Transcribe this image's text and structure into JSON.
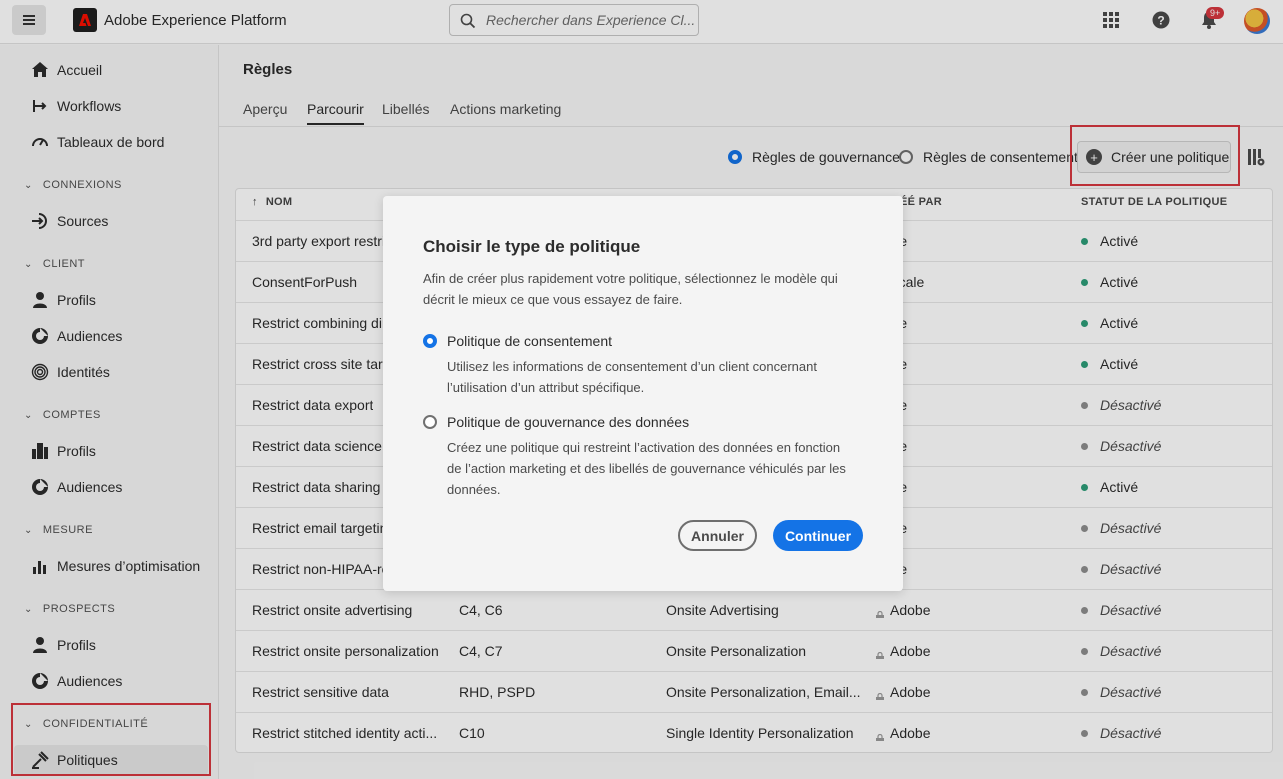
{
  "app": {
    "title": "Adobe Experience Platform"
  },
  "search": {
    "placeholder": "Rechercher dans Experience Cl..."
  },
  "topbar": {
    "notifications_badge": "9+"
  },
  "sidebar": {
    "items": [
      {
        "label": "Accueil",
        "icon": "home-icon"
      },
      {
        "label": "Workflows",
        "icon": "workflow-icon"
      },
      {
        "label": "Tableaux de bord",
        "icon": "dashboard-icon"
      }
    ],
    "sections": [
      {
        "label": "CONNEXIONS",
        "items": [
          {
            "label": "Sources",
            "icon": "sources-icon"
          }
        ]
      },
      {
        "label": "CLIENT",
        "items": [
          {
            "label": "Profils",
            "icon": "profile-icon"
          },
          {
            "label": "Audiences",
            "icon": "audience-icon"
          },
          {
            "label": "Identités",
            "icon": "fingerprint-icon"
          }
        ]
      },
      {
        "label": "COMPTES",
        "items": [
          {
            "label": "Profils",
            "icon": "building-icon"
          },
          {
            "label": "Audiences",
            "icon": "audience-icon"
          }
        ]
      },
      {
        "label": "MESURE",
        "items": [
          {
            "label": "Mesures d’optimisation",
            "icon": "metrics-icon"
          }
        ]
      },
      {
        "label": "PROSPECTS",
        "items": [
          {
            "label": "Profils",
            "icon": "profile-icon"
          },
          {
            "label": "Audiences",
            "icon": "audience-icon"
          }
        ]
      },
      {
        "label": "CONFIDENTIALITÉ",
        "items": [
          {
            "label": "Politiques",
            "icon": "policy-icon"
          }
        ]
      }
    ]
  },
  "main": {
    "title": "Règles",
    "tabs": [
      "Aperçu",
      "Parcourir",
      "Libellés",
      "Actions marketing"
    ],
    "selected_tab": "Parcourir",
    "filter": {
      "governance_label": "Règles de gouvernance",
      "consent_label": "Règles de consentement",
      "selected": "governance"
    },
    "create_button": "Créer une politique",
    "table": {
      "headers": {
        "name": "NOM",
        "created_by": "ÉÉ PAR",
        "status": "STATUT DE LA POLITIQUE"
      },
      "rows": [
        {
          "name": "3rd party export restric",
          "labels": "",
          "actions": "",
          "created_by": "dobe",
          "status": "Activé",
          "active": true
        },
        {
          "name": "ConsentForPush",
          "labels": "",
          "actions": "",
          "created_by": "o locale",
          "status": "Activé",
          "active": true
        },
        {
          "name": "Restrict combining dire",
          "labels": "",
          "actions": "",
          "created_by": "dobe",
          "status": "Activé",
          "active": true
        },
        {
          "name": "Restrict cross site target",
          "labels": "",
          "actions": "",
          "created_by": "dobe",
          "status": "Activé",
          "active": true
        },
        {
          "name": "Restrict data export",
          "labels": "",
          "actions": "",
          "created_by": "dobe",
          "status": "Désactivé",
          "active": false
        },
        {
          "name": "Restrict data science",
          "labels": "",
          "actions": "",
          "created_by": "dobe",
          "status": "Désactivé",
          "active": false
        },
        {
          "name": "Restrict data sharing",
          "labels": "",
          "actions": "",
          "created_by": "dobe",
          "status": "Activé",
          "active": true
        },
        {
          "name": "Restrict email targeting",
          "labels": "",
          "actions": "",
          "created_by": "dobe",
          "status": "Désactivé",
          "active": false
        },
        {
          "name": "Restrict non-HIPAA-rea",
          "labels": "",
          "actions": "",
          "created_by": "dobe",
          "status": "Désactivé",
          "active": false
        },
        {
          "name": "Restrict onsite advertising",
          "labels": "C4, C6",
          "actions": "Onsite Advertising",
          "created_by": "Adobe",
          "status": "Désactivé",
          "active": false
        },
        {
          "name": "Restrict onsite personalization",
          "labels": "C4, C7",
          "actions": "Onsite Personalization",
          "created_by": "Adobe",
          "status": "Désactivé",
          "active": false
        },
        {
          "name": "Restrict sensitive data",
          "labels": "RHD, PSPD",
          "actions": "Onsite Personalization, Email...",
          "created_by": "Adobe",
          "status": "Désactivé",
          "active": false
        },
        {
          "name": "Restrict stitched identity acti...",
          "labels": "C10",
          "actions": "Single Identity Personalization",
          "created_by": "Adobe",
          "status": "Désactivé",
          "active": false
        }
      ]
    }
  },
  "dialog": {
    "title": "Choisir le type de politique",
    "description": "Afin de créer plus rapidement votre politique, sélectionnez le modèle qui décrit le mieux ce que vous essayez de faire.",
    "options": [
      {
        "label": "Politique de consentement",
        "description": "Utilisez les informations de consentement d’un client concernant l’utilisation d’un attribut spécifique.",
        "selected": true
      },
      {
        "label": "Politique de gouvernance des données",
        "description": "Créez une politique qui restreint l’activation des données en fonction de l’action marketing et des libellés de gouvernance véhiculés par les données.",
        "selected": false
      }
    ],
    "cancel_label": "Annuler",
    "continue_label": "Continuer"
  },
  "colors": {
    "accent": "#1473e6",
    "active_dot": "#2d9d78",
    "inactive_dot": "#8e8e8e",
    "highlight": "#d7373f"
  }
}
